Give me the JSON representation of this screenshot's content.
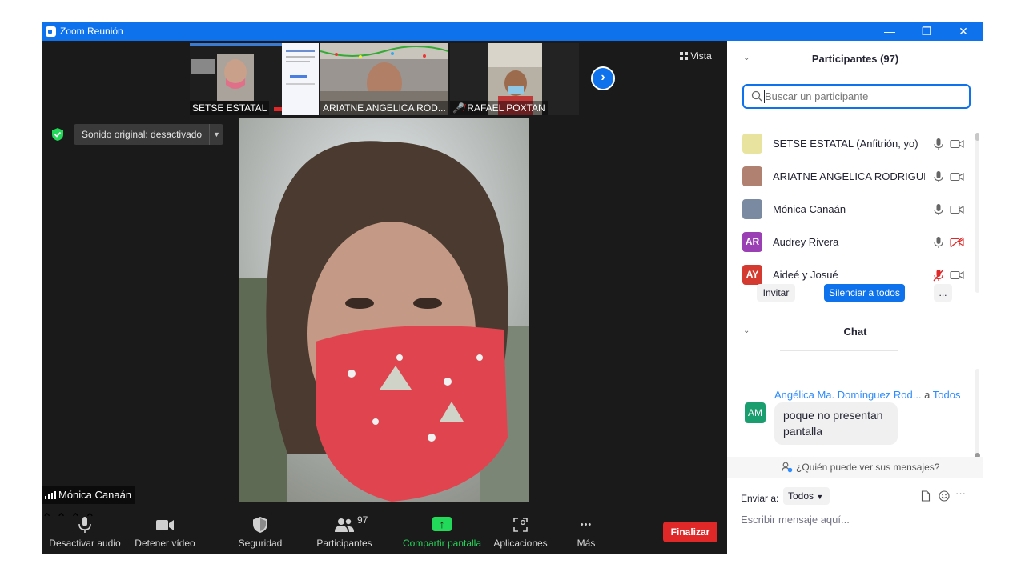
{
  "window": {
    "title": "Zoom Reunión",
    "controls": {
      "minimize": "—",
      "restore": "❐",
      "close": "✕"
    }
  },
  "meeting": {
    "view_label": "Vista",
    "sound_toggle_label": "Sonido original: desactivado",
    "active_speaker": "Mónica Canaán",
    "thumbnails": [
      {
        "name": "SETSE ESTATAL"
      },
      {
        "name": "ARIATNE ANGELICA ROD..."
      },
      {
        "name": "RAFAEL POXTAN"
      }
    ],
    "participants_count_badge": "97"
  },
  "toolbar": {
    "mute_label": "Desactivar audio",
    "video_label": "Detener vídeo",
    "security_label": "Seguridad",
    "participants_label": "Participantes",
    "share_label": "Compartir pantalla",
    "apps_label": "Aplicaciones",
    "more_label": "Más",
    "end_label": "Finalizar",
    "caret": "⌃",
    "more_dots": "•••",
    "share_arrow": "↑"
  },
  "participants_panel": {
    "title": "Participantes (97)",
    "collapse_glyph": "⌄",
    "search_placeholder": "Buscar un participante",
    "participants": [
      {
        "name": "SETSE ESTATAL (Anfitrión, yo)",
        "avatar": "",
        "avatar_color": "#e8e4a0",
        "mic": "on",
        "cam": "on"
      },
      {
        "name": "ARIATNE ANGELICA RODRIGUE...",
        "avatar": "",
        "avatar_color": "#b08070",
        "mic": "on",
        "cam": "on"
      },
      {
        "name": "Mónica Canaán",
        "avatar": "",
        "avatar_color": "#7a8aa0",
        "mic": "on",
        "cam": "on"
      },
      {
        "name": "Audrey Rivera",
        "avatar": "AR",
        "avatar_color": "#9b3fb5",
        "mic": "on",
        "cam": "off"
      },
      {
        "name": "Aideé y Josué",
        "avatar": "AY",
        "avatar_color": "#d43a2f",
        "mic": "off",
        "cam": "on"
      }
    ],
    "invite_label": "Invitar",
    "mute_all_label": "Silenciar a todos",
    "more_label": "..."
  },
  "chat_panel": {
    "title": "Chat",
    "messages": [
      {
        "avatar": "AM",
        "sender": "Angélica Ma. Domínguez Rod...",
        "to_prefix": "a",
        "to": "Todos",
        "text": "poque no presentan pantalla"
      }
    ],
    "who_can_see": "¿Quién puede ver sus mensajes?",
    "send_to_label": "Enviar a:",
    "send_to_value": "Todos",
    "input_placeholder": "Escribir mensaje aquí...",
    "more_glyph": "···"
  },
  "colors": {
    "zoom_blue": "#0e72ed",
    "end_red": "#e02828",
    "share_green": "#23d959",
    "mute_red": "#e02828"
  }
}
